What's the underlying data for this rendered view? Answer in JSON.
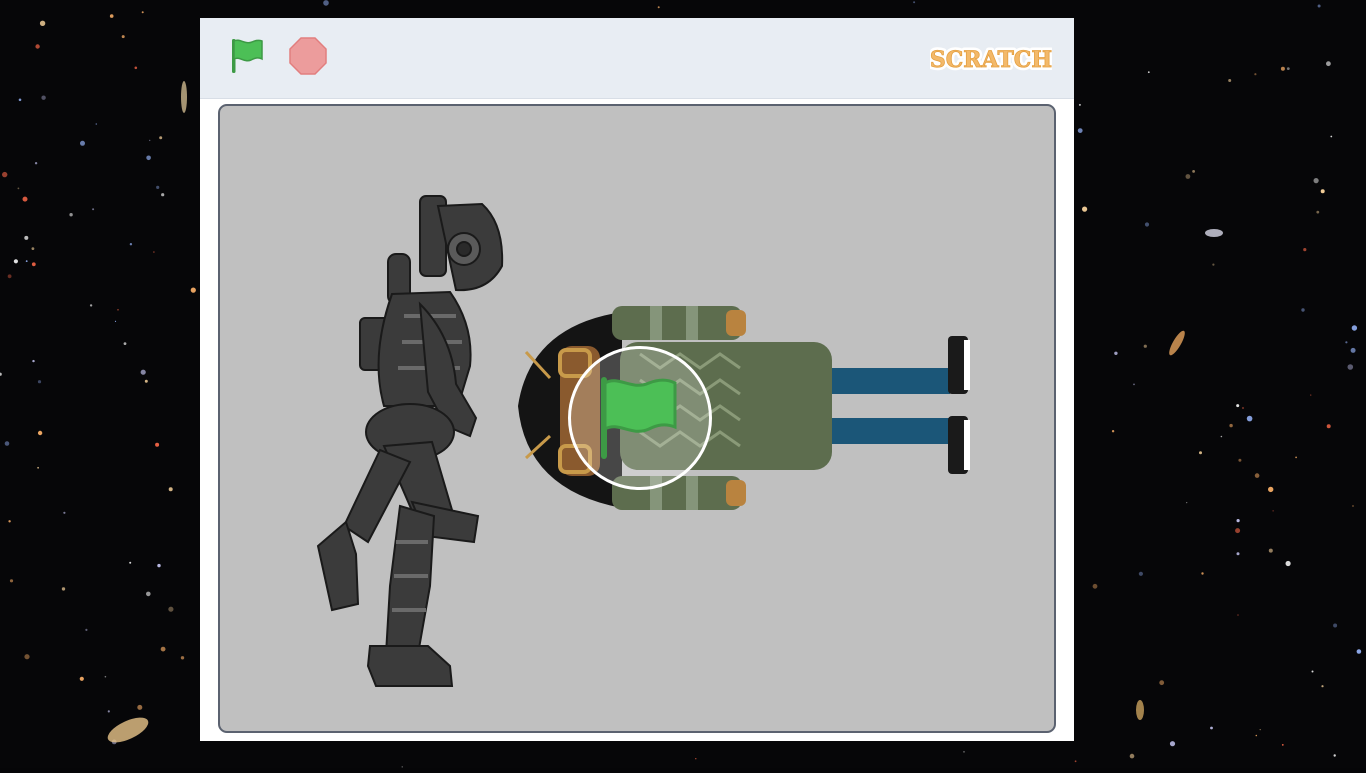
{
  "app": {
    "logo_text": "SCRATCH"
  },
  "controls": {
    "green_flag_icon": "green-flag-icon",
    "stop_icon": "stop-sign-icon"
  },
  "stage": {
    "sprites": [
      {
        "name": "robot-sprite",
        "icon": "robot-runner"
      },
      {
        "name": "character-sprite",
        "icon": "person-lying-down"
      }
    ],
    "start_overlay_icon": "green-flag-icon"
  },
  "colors": {
    "flag_green": "#4cbf56",
    "stop_red": "#ec9c9c",
    "logo_orange": "#f3b96a",
    "stage_bg": "#c0c0c0",
    "controls_bg": "#e8edf3"
  }
}
